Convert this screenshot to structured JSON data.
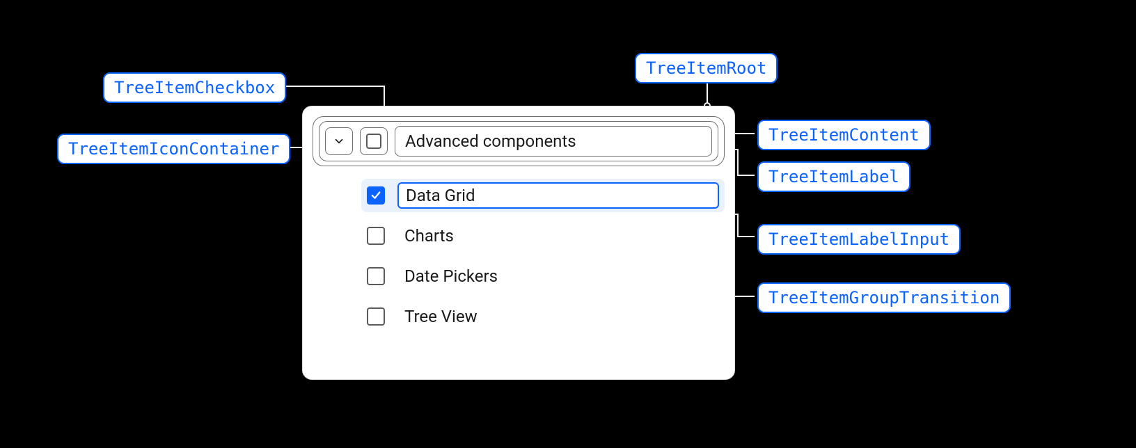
{
  "callouts": {
    "root": "TreeItemRoot",
    "content": "TreeItemContent",
    "label": "TreeItemLabel",
    "labelInput": "TreeItemLabelInput",
    "group": "TreeItemGroupTransition",
    "checkbox": "TreeItemCheckbox",
    "iconContainer": "TreeItemIconContainer"
  },
  "tree": {
    "parent_label": "Advanced components",
    "children": [
      {
        "label": "Data Grid",
        "checked": true,
        "editing": true
      },
      {
        "label": "Charts",
        "checked": false,
        "editing": false
      },
      {
        "label": "Date Pickers",
        "checked": false,
        "editing": false
      },
      {
        "label": "Tree View",
        "checked": false,
        "editing": false
      }
    ]
  }
}
